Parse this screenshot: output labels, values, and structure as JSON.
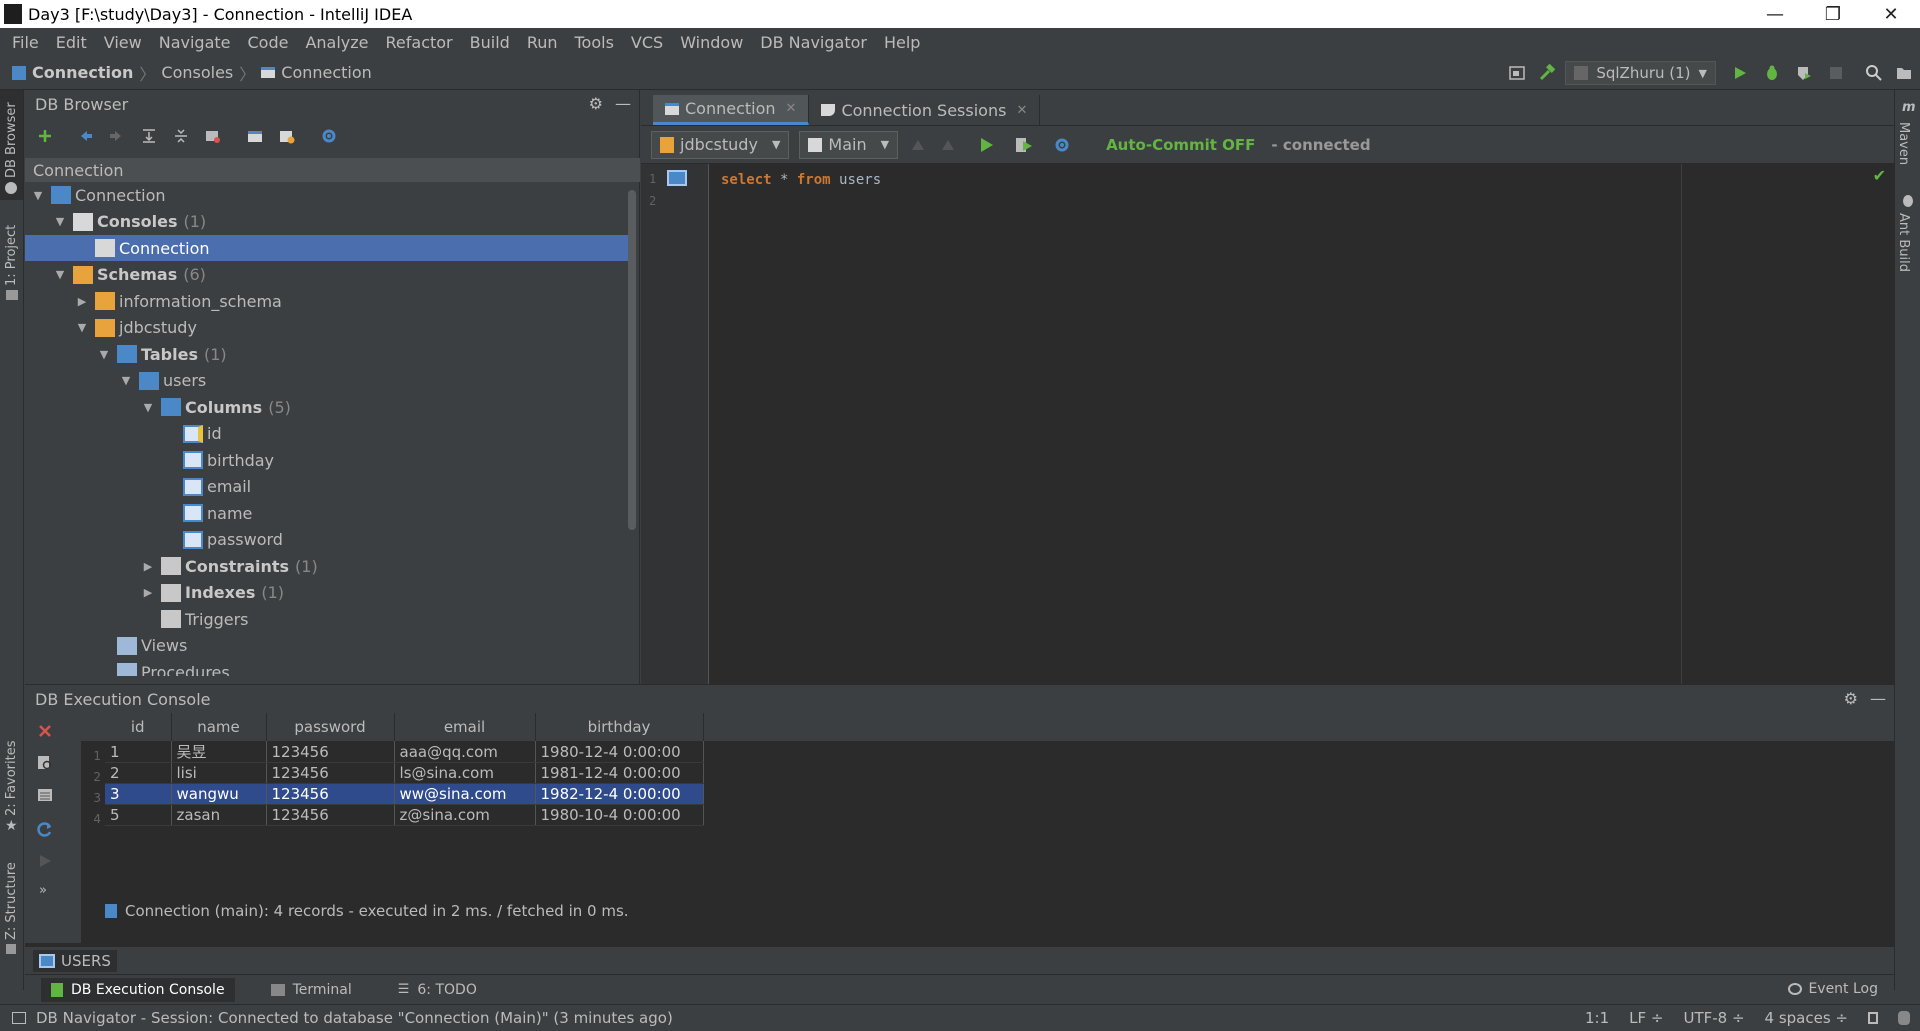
{
  "window": {
    "title": "Day3 [F:\\study\\Day3] - Connection - IntelliJ IDEA",
    "minimize": "—",
    "restore": "❐",
    "close": "✕"
  },
  "menu": [
    "File",
    "Edit",
    "View",
    "Navigate",
    "Code",
    "Analyze",
    "Refactor",
    "Build",
    "Run",
    "Tools",
    "VCS",
    "Window",
    "DB Navigator",
    "Help"
  ],
  "breadcrumb": {
    "items": [
      "Connection",
      "Consoles",
      "Connection"
    ],
    "separator": "〉"
  },
  "run_config": {
    "label": "SqlZhuru (1)"
  },
  "left_stripe": {
    "db_browser": "DB Browser",
    "project": "1: Project",
    "favorites": "2: Favorites",
    "structure": "Z: Structure"
  },
  "right_stripe": {
    "maven": "Maven",
    "ant": "Ant Build"
  },
  "db_browser": {
    "title": "DB Browser",
    "connection_select": "Connection",
    "tree": [
      {
        "depth": 0,
        "label": "Connection",
        "toggle": "▼",
        "icon": "connection-icon"
      },
      {
        "depth": 1,
        "label": "Consoles",
        "count": "(1)",
        "bold": true,
        "toggle": "▼",
        "icon": "consoles-icon"
      },
      {
        "depth": 2,
        "label": "Connection",
        "selected": true,
        "icon": "console-icon"
      },
      {
        "depth": 1,
        "label": "Schemas",
        "count": "(6)",
        "bold": true,
        "toggle": "▼",
        "icon": "schemas-icon"
      },
      {
        "depth": 2,
        "label": "information_schema",
        "toggle": "▶",
        "icon": "schema-icon"
      },
      {
        "depth": 2,
        "label": "jdbcstudy",
        "toggle": "▼",
        "icon": "schema-icon"
      },
      {
        "depth": 3,
        "label": "Tables",
        "count": "(1)",
        "bold": true,
        "toggle": "▼",
        "icon": "tables-icon"
      },
      {
        "depth": 4,
        "label": "users",
        "toggle": "▼",
        "icon": "table-icon"
      },
      {
        "depth": 5,
        "label": "Columns",
        "count": "(5)",
        "bold": true,
        "toggle": "▼",
        "icon": "columns-icon"
      },
      {
        "depth": 6,
        "label": "id",
        "icon": "pk-column-icon"
      },
      {
        "depth": 6,
        "label": "birthday",
        "icon": "column-icon"
      },
      {
        "depth": 6,
        "label": "email",
        "icon": "column-icon"
      },
      {
        "depth": 6,
        "label": "name",
        "icon": "column-icon"
      },
      {
        "depth": 6,
        "label": "password",
        "icon": "column-icon"
      },
      {
        "depth": 5,
        "label": "Constraints",
        "count": "(1)",
        "bold": true,
        "toggle": "▶",
        "icon": "constraints-icon"
      },
      {
        "depth": 5,
        "label": "Indexes",
        "count": "(1)",
        "bold": true,
        "toggle": "▶",
        "icon": "indexes-icon"
      },
      {
        "depth": 5,
        "label": "Triggers",
        "icon": "triggers-icon"
      },
      {
        "depth": 3,
        "label": "Views",
        "icon": "views-icon"
      },
      {
        "depth": 3,
        "label": "Procedures",
        "icon": "procedures-icon"
      }
    ]
  },
  "editor": {
    "tabs": [
      {
        "label": "Connection",
        "active": true,
        "close": "✕"
      },
      {
        "label": "Connection Sessions",
        "active": false,
        "close": "✕"
      }
    ],
    "schema_combo": "jdbcstudy",
    "session_combo": "Main",
    "autocommit": "Auto-Commit OFF",
    "conn_status": "- connected",
    "lines": [
      {
        "no": "1",
        "keyword1": "select",
        "mid": " * ",
        "keyword2": "from",
        "rest": " users"
      },
      {
        "no": "2"
      }
    ]
  },
  "console": {
    "title": "DB Execution Console",
    "columns": [
      "id",
      "name",
      "password",
      "email",
      "birthday"
    ],
    "rows": [
      {
        "n": "1",
        "cells": [
          "1",
          "吴昱",
          "123456",
          "aaa@qq.com",
          "1980-12-4 0:00:00"
        ]
      },
      {
        "n": "2",
        "cells": [
          "2",
          "lisi",
          "123456",
          "ls@sina.com",
          "1981-12-4 0:00:00"
        ]
      },
      {
        "n": "3",
        "cells": [
          "3",
          "wangwu",
          "123456",
          "ww@sina.com",
          "1982-12-4 0:00:00"
        ],
        "selected": true
      },
      {
        "n": "4",
        "cells": [
          "5",
          "zasan",
          "123456",
          "z@sina.com",
          "1980-10-4 0:00:00"
        ]
      }
    ],
    "status": "Connection (main): 4 records  - executed in 2 ms. / fetched in 0 ms."
  },
  "result_tab": "USERS",
  "bottom_tabs": [
    {
      "label": "DB Execution Console",
      "active": true
    },
    {
      "label": "Terminal"
    },
    {
      "label": "6: TODO"
    }
  ],
  "event_log": "Event Log",
  "statusbar": {
    "message": "DB Navigator - Session: Connected to database \"Connection (Main)\" (3 minutes ago)",
    "position": "1:1",
    "line_sep": "LF ÷",
    "encoding": "UTF-8 ÷",
    "indent": "4 spaces ÷"
  },
  "colors": {
    "accent": "#4b6eaf",
    "selected_row": "#2f4b8c",
    "green": "#62b543",
    "keyword": "#cc7832"
  }
}
